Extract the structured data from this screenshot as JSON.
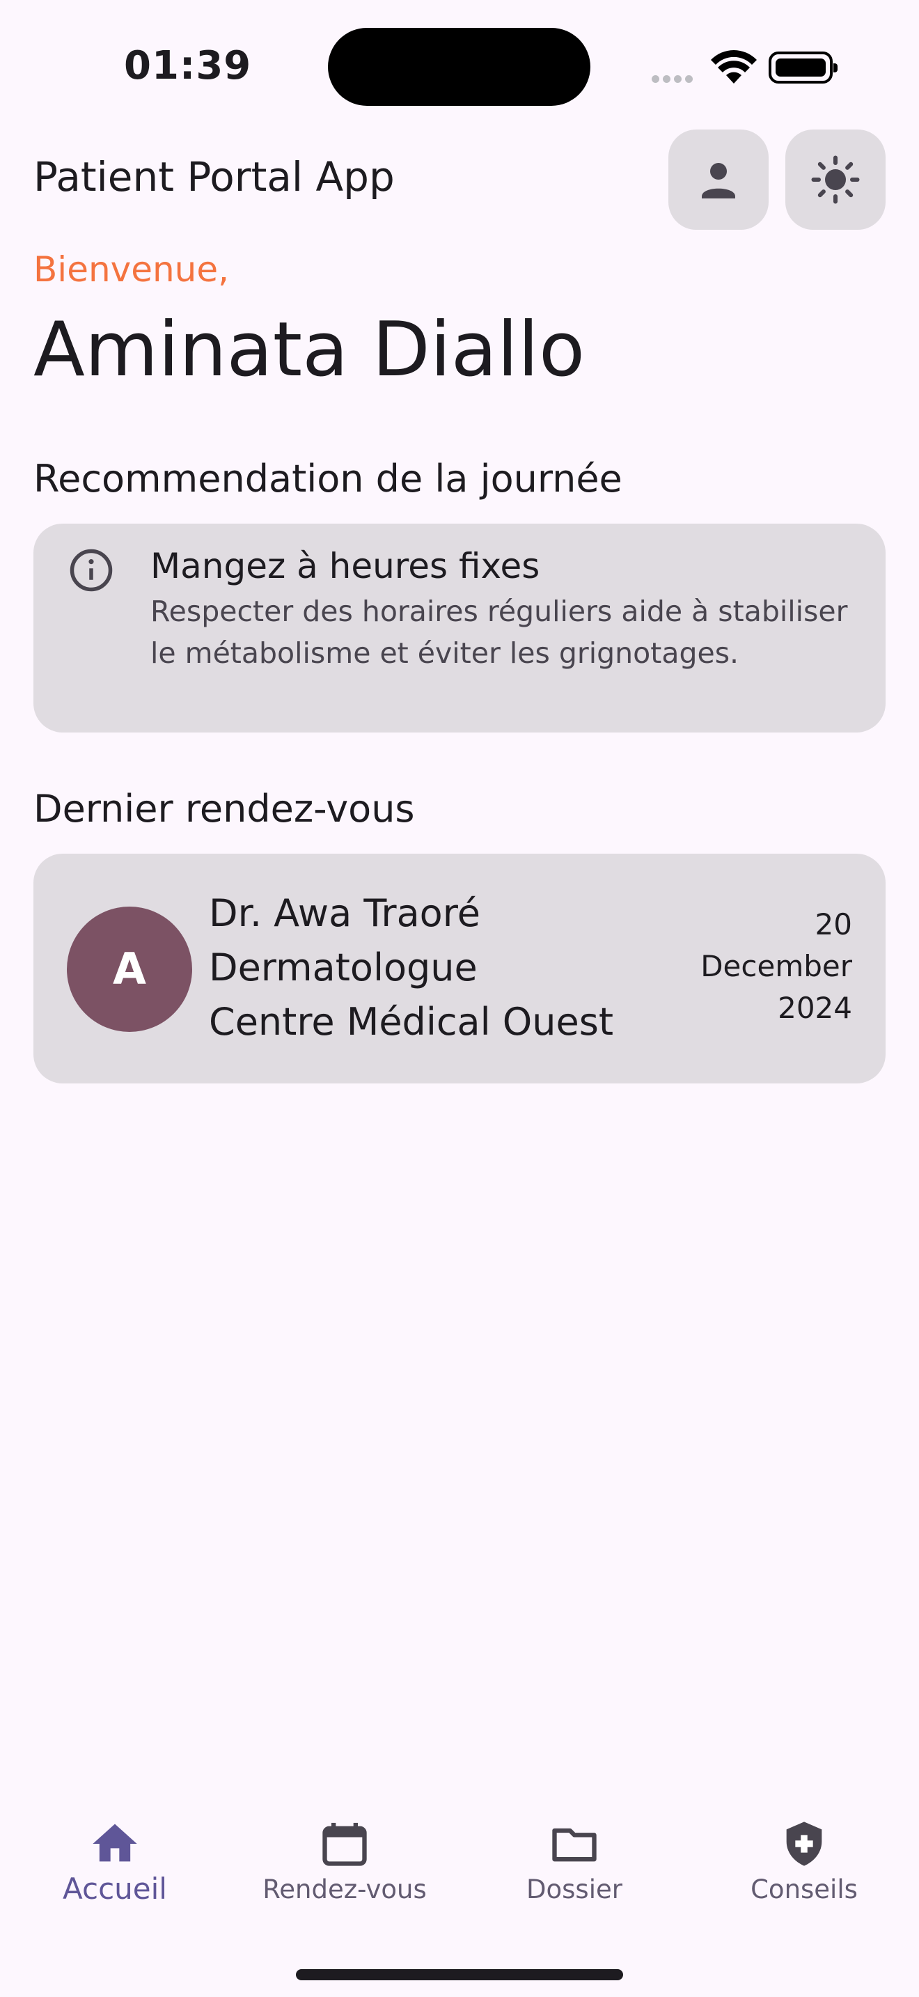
{
  "status_bar": {
    "time": "01:39"
  },
  "header": {
    "title": "Patient Portal App",
    "profile_icon": "person-icon",
    "theme_icon": "sun-icon"
  },
  "greeting": {
    "welcome": "Bienvenue,",
    "name": "Aminata Diallo"
  },
  "recommendation": {
    "section_title": "Recommendation de la journée",
    "icon": "info-icon",
    "title": "Mangez à heures fixes",
    "body": "Respecter des horaires réguliers aide à stabiliser le métabolisme et éviter les grignotages."
  },
  "last_appointment": {
    "section_title": "Dernier rendez-vous",
    "avatar_initial": "A",
    "doctor": "Dr. Awa Traoré",
    "specialty": "Dermatologue",
    "center": "Centre Médical Ouest",
    "date_day": "20",
    "date_month": "December",
    "date_year": "2024"
  },
  "bottom_nav": {
    "items": [
      {
        "label": "Accueil",
        "icon": "home-icon",
        "active": true
      },
      {
        "label": "Rendez-vous",
        "icon": "calendar-icon",
        "active": false
      },
      {
        "label": "Dossier",
        "icon": "folder-icon",
        "active": false
      },
      {
        "label": "Conseils",
        "icon": "shield-plus-icon",
        "active": false
      }
    ]
  },
  "colors": {
    "background": "#FDF7FE",
    "card": "#E0DCE1",
    "accent_orange": "#F4733F",
    "avatar": "#7C5264",
    "nav_active": "#5F5698"
  }
}
